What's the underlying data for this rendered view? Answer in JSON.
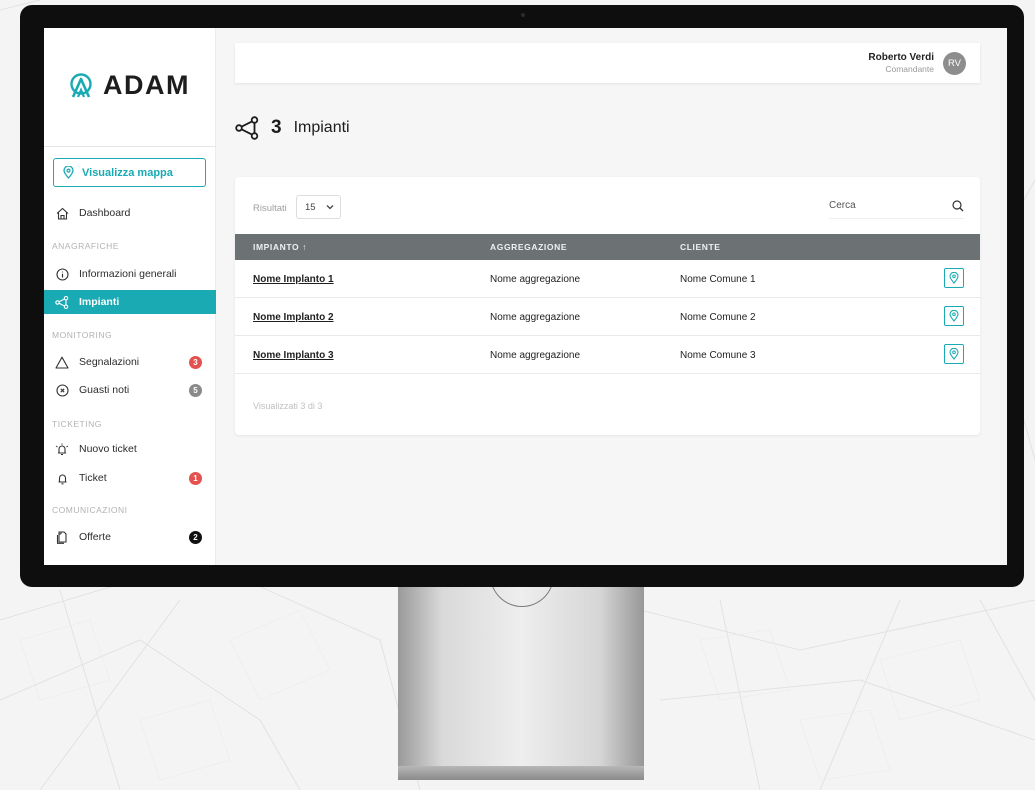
{
  "app": {
    "logo": "ADAM",
    "brand_color": "#19aab3"
  },
  "sidebar": {
    "map_button": "Visualizza mappa",
    "dashboard": "Dashboard",
    "sections": [
      {
        "title": "ANAGRAFICHE"
      },
      {
        "title": "MONITORING"
      },
      {
        "title": "TICKETING"
      },
      {
        "title": "COMUNICAZIONI"
      }
    ],
    "items": [
      {
        "label": "Informazioni generali",
        "icon": "info-icon"
      },
      {
        "label": "Impianti",
        "icon": "network-icon",
        "active": true
      },
      {
        "label": "Segnalazioni",
        "icon": "warning-icon",
        "badge": "3",
        "badge_color": "#e4524f"
      },
      {
        "label": "Guasti noti",
        "icon": "x-circle-icon",
        "badge": "5",
        "badge_color": "#8a8a8a"
      },
      {
        "label": "Nuovo ticket",
        "icon": "bell-plus-icon"
      },
      {
        "label": "Ticket",
        "icon": "bell-icon",
        "badge": "1",
        "badge_color": "#e4524f"
      },
      {
        "label": "Offerte",
        "icon": "copy-icon",
        "badge": "2",
        "badge_color": "#111111"
      }
    ]
  },
  "header": {
    "user_name": "Roberto Verdi",
    "user_role": "Comandante",
    "avatar_initials": "RV"
  },
  "page": {
    "count": "3",
    "title": "Impianti"
  },
  "table": {
    "results_label": "Risultati",
    "per_page": "15",
    "search_placeholder": "Cerca",
    "columns": [
      "IMPIANTO ↑",
      "AGGREGAZIONE",
      "CLIENTE"
    ],
    "rows": [
      {
        "impianto": "Nome Implanto 1",
        "aggregazione": "Nome aggregazione",
        "cliente": "Nome Comune 1"
      },
      {
        "impianto": "Nome Implanto 2",
        "aggregazione": "Nome aggregazione",
        "cliente": "Nome Comune 2"
      },
      {
        "impianto": "Nome Implanto 3",
        "aggregazione": "Nome aggregazione",
        "cliente": "Nome Comune 3"
      }
    ],
    "footer": "Visualizzati 3 di 3"
  }
}
